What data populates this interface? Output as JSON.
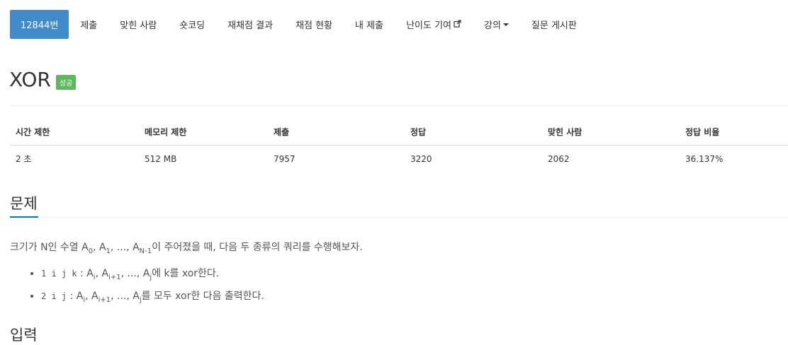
{
  "nav": {
    "problem_tab": "12844번",
    "items": [
      "제출",
      "맞힌 사람",
      "숏코딩",
      "재채점 결과",
      "채점 현황",
      "내 제출",
      "난이도 기여",
      "강의",
      "질문 게시판"
    ]
  },
  "problem": {
    "title": "XOR",
    "result_badge": "성공"
  },
  "info_table": {
    "headers": [
      "시간 제한",
      "메모리 제한",
      "제출",
      "정답",
      "맞힌 사람",
      "정답 비율"
    ],
    "values": [
      "2 초",
      "512 MB",
      "7957",
      "3220",
      "2062",
      "36.137%"
    ]
  },
  "sections": {
    "problem_heading": "문제",
    "input_heading": "입력"
  },
  "description": {
    "part1": "크기가 N인 수열 A",
    "sub0": "0",
    "part2": ", A",
    "sub1": "1",
    "part3": ", ..., A",
    "subN": "N-1",
    "part4": "이 주어졌을 때, 다음 두 종류의 쿼리를 수행해보자."
  },
  "queries": [
    {
      "code": "1 i j k",
      "text_a": ": A",
      "sub_i": "i",
      "text_b": ", A",
      "sub_i1": "i+1",
      "text_c": ", ..., A",
      "sub_j": "j",
      "text_d": "에 k를 xor한다."
    },
    {
      "code": "2 i j",
      "text_a": ": A",
      "sub_i": "i",
      "text_b": ", A",
      "sub_i1": "i+1",
      "text_c": ", ..., A",
      "sub_j": "j",
      "text_d": "를 모두 xor한 다음 출력한다."
    }
  ],
  "colors": {
    "active_tab": "#428bca",
    "success_badge": "#5cb85c",
    "section_accent": "#0076c0"
  }
}
